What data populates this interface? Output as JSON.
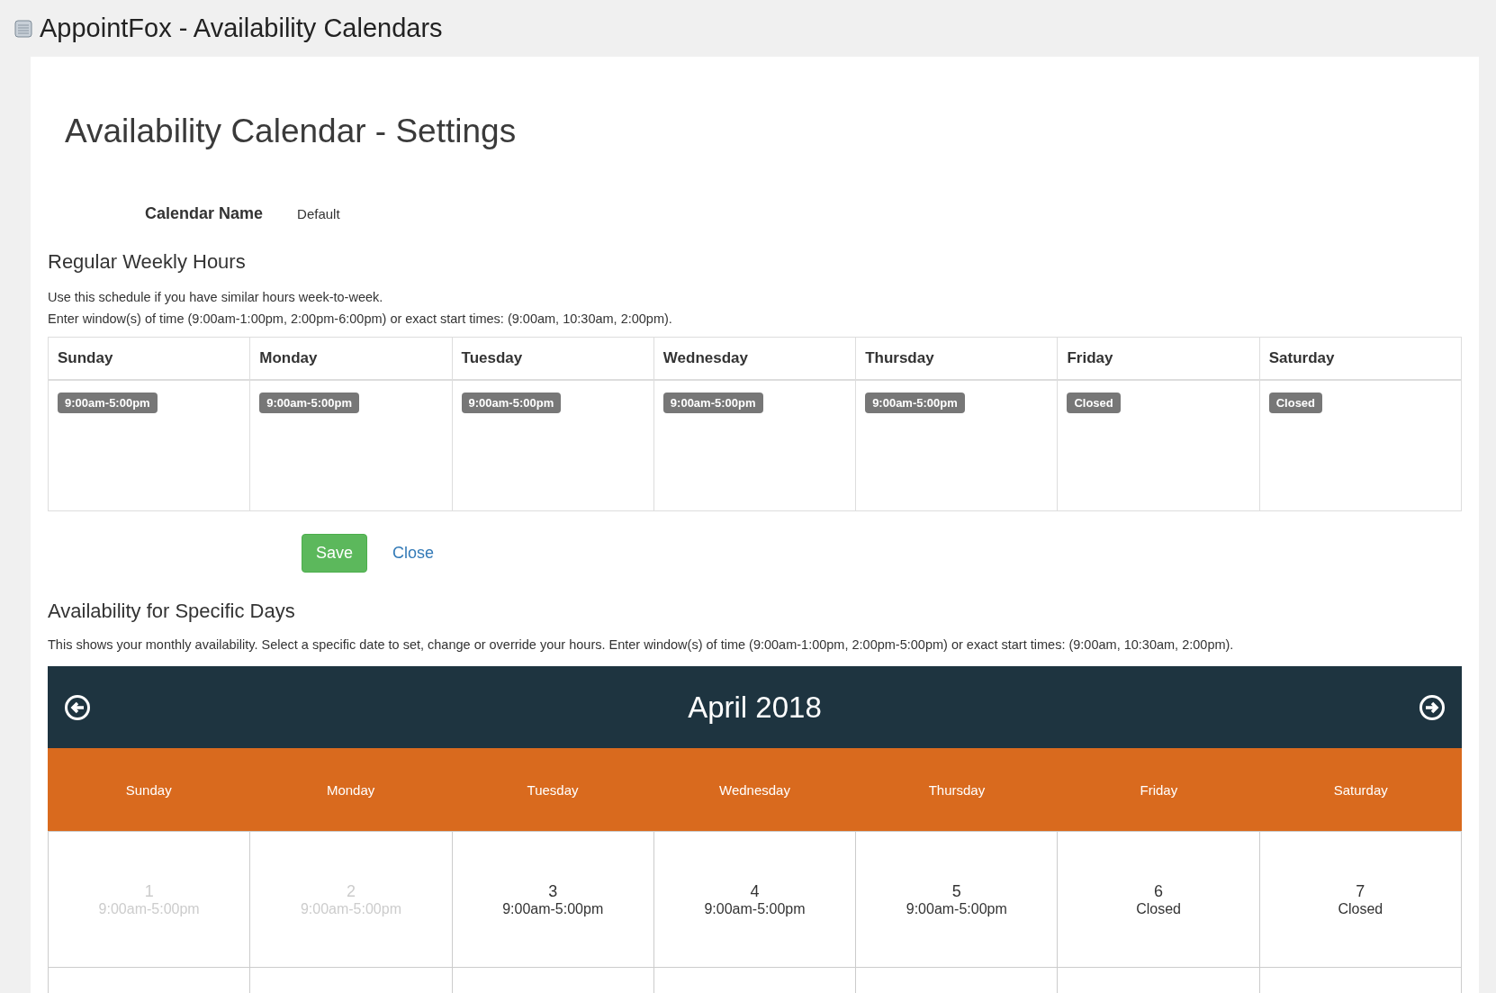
{
  "window": {
    "title": "AppointFox - Availability Calendars"
  },
  "heading": "Availability Calendar - Settings",
  "calendar_name": {
    "label": "Calendar Name",
    "value": "Default"
  },
  "weekly": {
    "title": "Regular Weekly Hours",
    "description": [
      "Use this schedule if you have similar hours week-to-week.",
      "Enter window(s) of time (9:00am-1:00pm, 2:00pm-6:00pm) or exact start times: (9:00am, 10:30am, 2:00pm)."
    ],
    "days": [
      {
        "name": "Sunday",
        "hours": "9:00am-5:00pm"
      },
      {
        "name": "Monday",
        "hours": "9:00am-5:00pm"
      },
      {
        "name": "Tuesday",
        "hours": "9:00am-5:00pm"
      },
      {
        "name": "Wednesday",
        "hours": "9:00am-5:00pm"
      },
      {
        "name": "Thursday",
        "hours": "9:00am-5:00pm"
      },
      {
        "name": "Friday",
        "hours": "Closed"
      },
      {
        "name": "Saturday",
        "hours": "Closed"
      }
    ]
  },
  "buttons": {
    "save": "Save",
    "close": "Close"
  },
  "specific": {
    "title": "Availability for Specific Days",
    "description": "This shows your monthly availability. Select a specific date to set, change or override your hours. Enter window(s) of time (9:00am-1:00pm, 2:00pm-5:00pm) or exact start times: (9:00am, 10:30am, 2:00pm).",
    "month": "April 2018",
    "weekdays": [
      "Sunday",
      "Monday",
      "Tuesday",
      "Wednesday",
      "Thursday",
      "Friday",
      "Saturday"
    ],
    "cells": [
      {
        "date": "1",
        "hours": "9:00am-5:00pm",
        "past": true
      },
      {
        "date": "2",
        "hours": "9:00am-5:00pm",
        "past": true
      },
      {
        "date": "3",
        "hours": "9:00am-5:00pm",
        "past": false
      },
      {
        "date": "4",
        "hours": "9:00am-5:00pm",
        "past": false
      },
      {
        "date": "5",
        "hours": "9:00am-5:00pm",
        "past": false
      },
      {
        "date": "6",
        "hours": "Closed",
        "past": false
      },
      {
        "date": "7",
        "hours": "Closed",
        "past": false
      }
    ]
  }
}
